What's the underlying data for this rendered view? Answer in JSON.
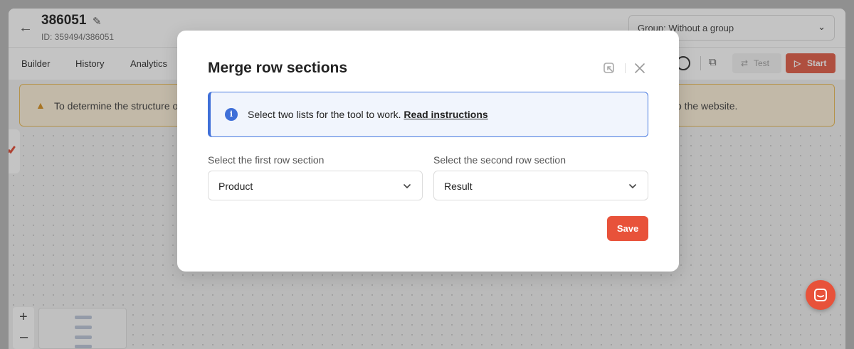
{
  "app": {
    "title": "386051",
    "id_label": "ID: 359494/386051",
    "group_select": "Group: Without a group"
  },
  "tabs": [
    "Builder",
    "History",
    "Analytics"
  ],
  "toolbar": {
    "test_label": "Test",
    "start_label": "Start"
  },
  "warning": {
    "text_start": "To determine the structure o",
    "text_end": "o the website."
  },
  "zoom": {
    "plus": "+",
    "minus": "–"
  },
  "modal": {
    "title": "Merge row sections",
    "info_text": "Select two lists for the tool to work.",
    "info_link": "Read instructions",
    "first_label": "Select the first row section",
    "first_value": "Product",
    "second_label": "Select the second row section",
    "second_value": "Result",
    "save_label": "Save"
  },
  "colors": {
    "accent": "#e8523a",
    "info_blue": "#3f6fd8",
    "warning_bg": "#fcefd6"
  }
}
